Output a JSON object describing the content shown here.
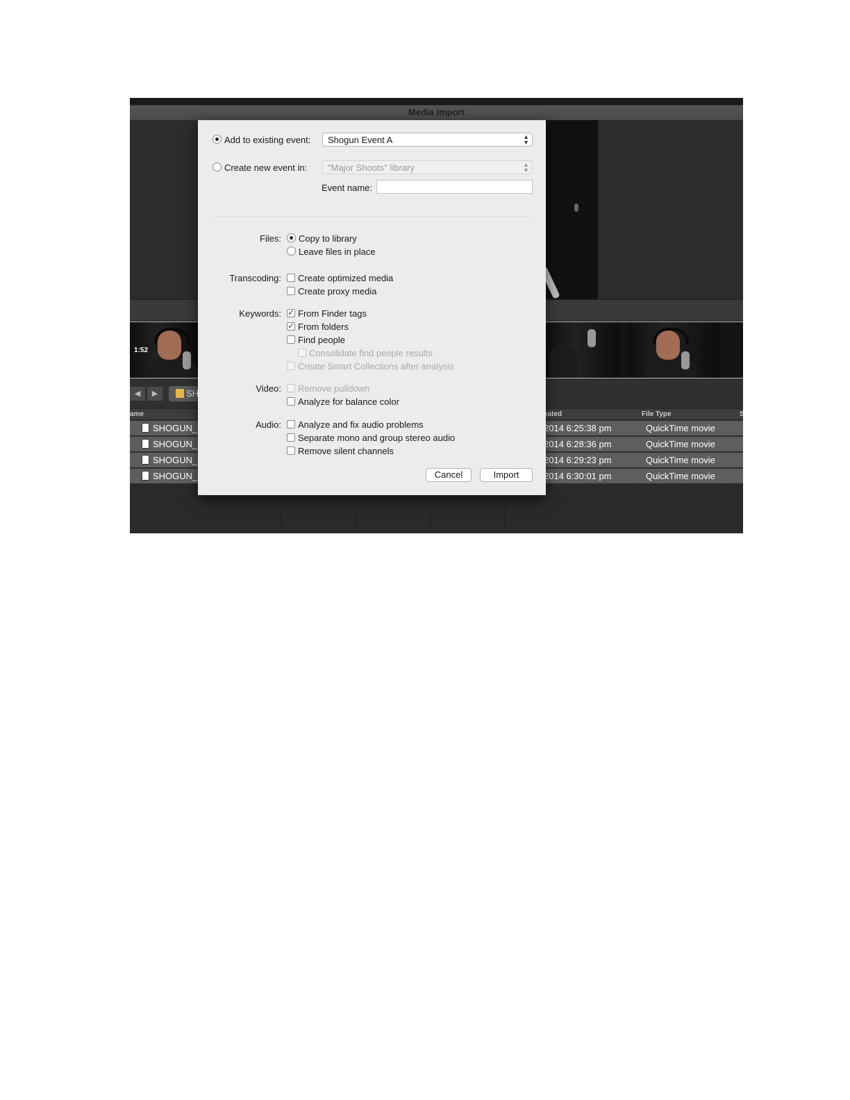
{
  "window": {
    "title": "Media Import"
  },
  "filmstrip": {
    "duration": "1:52"
  },
  "toolbar": {
    "back_icon": "◀",
    "forward_icon": "▶",
    "folder_label": "SH"
  },
  "list": {
    "columns": {
      "name": "ame",
      "created": "eated",
      "file_type": "File Type",
      "extra": "S"
    },
    "rows": [
      {
        "name": "SHOGUN_S",
        "created": "2014 6:25:38 pm",
        "file_type": "QuickTime movie"
      },
      {
        "name": "SHOGUN_S",
        "created": "2014 6:28:36 pm",
        "file_type": "QuickTime movie"
      },
      {
        "name": "SHOGUN_S",
        "created": "2014 6:29:23 pm",
        "file_type": "QuickTime movie"
      },
      {
        "name": "SHOGUN_S",
        "created": "2014 6:30:01 pm",
        "file_type": "QuickTime movie"
      }
    ]
  },
  "dialog": {
    "add_existing_label": "Add to existing event:",
    "add_existing_selected": true,
    "existing_event_value": "Shogun Event A",
    "create_new_label": "Create new event in:",
    "create_new_selected": false,
    "library_value": "\"Major Shoots\" library",
    "event_name_label": "Event name:",
    "event_name_value": "",
    "files": {
      "label": "Files:",
      "copy_label": "Copy to library",
      "copy_selected": true,
      "leave_label": "Leave files in place",
      "leave_selected": false
    },
    "transcoding": {
      "label": "Transcoding:",
      "optimized_label": "Create optimized media",
      "optimized_checked": false,
      "proxy_label": "Create proxy media",
      "proxy_checked": false
    },
    "keywords": {
      "label": "Keywords:",
      "finder_tags_label": "From Finder tags",
      "finder_tags_checked": true,
      "folders_label": "From folders",
      "folders_checked": true,
      "find_people_label": "Find people",
      "find_people_checked": false,
      "consolidate_label": "Consolidate find people results",
      "consolidate_checked": false,
      "smart_collections_label": "Create Smart Collections after analysis",
      "smart_collections_checked": false
    },
    "video": {
      "label": "Video:",
      "pulldown_label": "Remove pulldown",
      "pulldown_checked": false,
      "balance_label": "Analyze for balance color",
      "balance_checked": false
    },
    "audio": {
      "label": "Audio:",
      "fix_label": "Analyze and fix audio problems",
      "fix_checked": false,
      "separate_label": "Separate mono and group stereo audio",
      "separate_checked": false,
      "silent_label": "Remove silent channels",
      "silent_checked": false
    },
    "cancel_label": "Cancel",
    "import_label": "Import"
  }
}
